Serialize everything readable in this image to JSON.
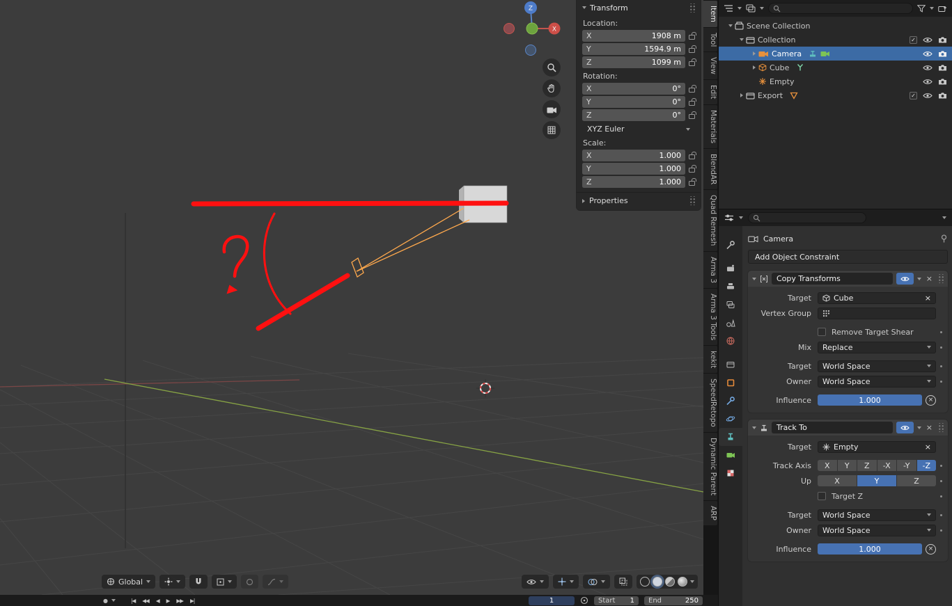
{
  "icons": {
    "close": "×",
    "check": "✓",
    "record_dot": "●",
    "playback": [
      "|◀",
      "◀◀",
      "◀",
      "▶",
      "▶▶",
      "▶|"
    ]
  },
  "viewport": {
    "orientation": "Global",
    "gizmo": {
      "z": "Z",
      "x": "X"
    }
  },
  "transform_panel": {
    "title": "Transform",
    "location_label": "Location:",
    "location": [
      {
        "axis": "X",
        "value": "1908 m"
      },
      {
        "axis": "Y",
        "value": "1594.9 m"
      },
      {
        "axis": "Z",
        "value": "1099 m"
      }
    ],
    "rotation_label": "Rotation:",
    "rotation": [
      {
        "axis": "X",
        "value": "0°"
      },
      {
        "axis": "Y",
        "value": "0°"
      },
      {
        "axis": "Z",
        "value": "0°"
      }
    ],
    "rotation_mode": "XYZ Euler",
    "scale_label": "Scale:",
    "scale": [
      {
        "axis": "X",
        "value": "1.000"
      },
      {
        "axis": "Y",
        "value": "1.000"
      },
      {
        "axis": "Z",
        "value": "1.000"
      }
    ],
    "properties_label": "Properties"
  },
  "sidebar_tabs": [
    "Item",
    "Tool",
    "View",
    "Edit",
    "Materials",
    "BlendAR",
    "Quad Remesh",
    "Arma 3",
    "Arma 3 Tools",
    "kekit",
    "SpeedRetopo",
    "Dynamic Parent",
    "ARP"
  ],
  "outliner": {
    "rows": [
      {
        "label": "Scene Collection"
      },
      {
        "label": "Collection"
      },
      {
        "label": "Camera"
      },
      {
        "label": "Cube"
      },
      {
        "label": "Empty"
      },
      {
        "label": "Export"
      }
    ]
  },
  "properties": {
    "breadcrumb": "Camera",
    "add_constraint": "Add Object Constraint",
    "copy_transforms": {
      "name": "Copy Transforms",
      "target_label": "Target",
      "target": "Cube",
      "vertex_group_label": "Vertex Group",
      "remove_target_shear_label": "Remove Target Shear",
      "mix_label": "Mix",
      "mix": "Replace",
      "target_space_label": "Target",
      "target_space": "World Space",
      "owner_label": "Owner",
      "owner_space": "World Space",
      "influence_label": "Influence",
      "influence": "1.000"
    },
    "track_to": {
      "name": "Track To",
      "target_label": "Target",
      "target": "Empty",
      "track_axis_label": "Track Axis",
      "track_axis_options": [
        "X",
        "Y",
        "Z",
        "-X",
        "-Y",
        "-Z"
      ],
      "up_label": "Up",
      "up_options": [
        "X",
        "Y",
        "Z"
      ],
      "target_z_label": "Target Z",
      "target_space_label": "Target",
      "target_space": "World Space",
      "owner_label": "Owner",
      "owner_space": "World Space",
      "influence_label": "Influence",
      "influence": "1.000"
    }
  },
  "timeline": {
    "current_frame": "1",
    "start_label": "Start",
    "start_value": "1",
    "end_label": "End",
    "end_value": "250"
  }
}
